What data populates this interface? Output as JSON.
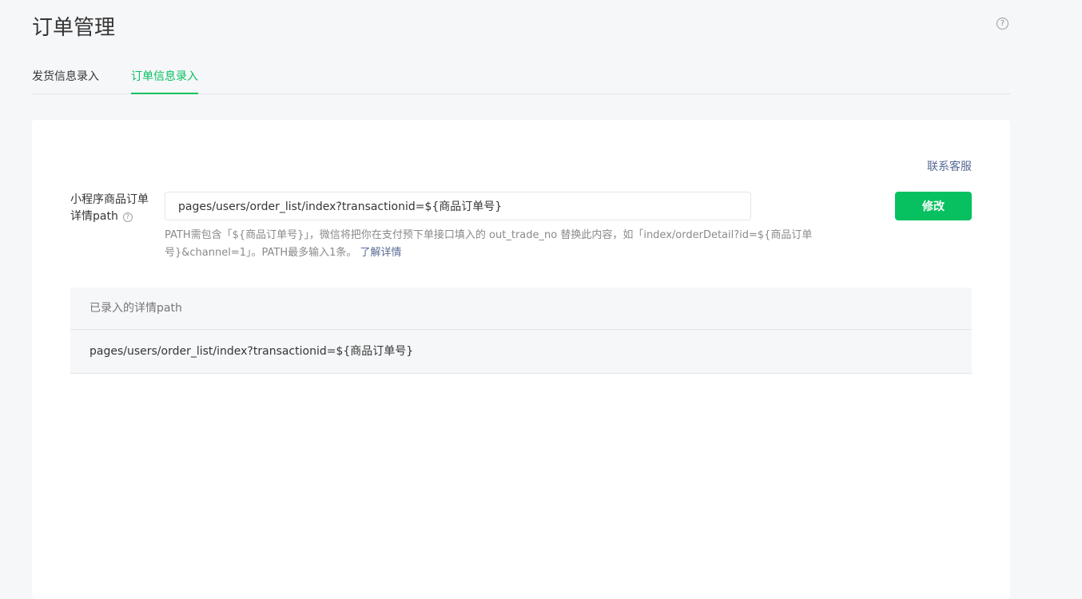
{
  "page": {
    "title": "订单管理",
    "help_icon": "question-circle-icon"
  },
  "tabs": [
    {
      "label": "发货信息录入",
      "active": false
    },
    {
      "label": "订单信息录入",
      "active": true
    }
  ],
  "card": {
    "contact_link": "联系客服",
    "form": {
      "label": "小程序商品订单详情path",
      "label_help_icon": "question-circle-icon",
      "input_value": "pages/users/order_list/index?transactionid=${商品订单号}",
      "submit_label": "修改",
      "hint_text": "PATH需包含「${商品订单号}」，微信将把你在支付预下单接口填入的 out_trade_no 替换此内容，如「index/orderDetail?id=${商品订单号}&channel=1」。PATH最多输入1条。",
      "hint_link": "了解详情"
    },
    "table": {
      "header": "已录入的详情path",
      "rows": [
        "pages/users/order_list/index?transactionid=${商品订单号}"
      ]
    }
  },
  "colors": {
    "accent": "#07c160",
    "link": "#576b95",
    "background": "#f6f7f9"
  }
}
